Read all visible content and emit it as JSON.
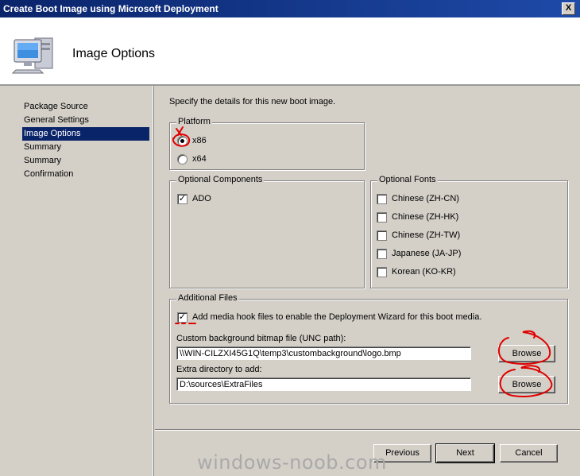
{
  "window": {
    "title": "Create Boot Image using Microsoft Deployment",
    "close_label": "X"
  },
  "header": {
    "title": "Image Options",
    "icon": "computer-icon"
  },
  "nav": {
    "items": [
      {
        "label": "Package Source"
      },
      {
        "label": "General Settings"
      },
      {
        "label": "Image Options"
      },
      {
        "label": "Summary"
      },
      {
        "label": "Summary"
      },
      {
        "label": "Confirmation"
      }
    ],
    "active_index": 2
  },
  "main": {
    "instruction": "Specify the details for this new boot image.",
    "platform": {
      "legend": "Platform",
      "options": [
        {
          "label": "x86",
          "checked": true
        },
        {
          "label": "x64",
          "checked": false
        }
      ]
    },
    "optional_components": {
      "legend": "Optional Components",
      "items": [
        {
          "label": "ADO",
          "checked": true
        }
      ]
    },
    "optional_fonts": {
      "legend": "Optional Fonts",
      "items": [
        {
          "label": "Chinese (ZH-CN)",
          "checked": false
        },
        {
          "label": "Chinese (ZH-HK)",
          "checked": false
        },
        {
          "label": "Chinese (ZH-TW)",
          "checked": false
        },
        {
          "label": "Japanese (JA-JP)",
          "checked": false
        },
        {
          "label": "Korean (KO-KR)",
          "checked": false
        }
      ]
    },
    "additional_files": {
      "legend": "Additional Files",
      "media_hook_label": "Add media hook files to enable the Deployment Wizard for this boot media.",
      "media_hook_checked": true,
      "bitmap_label": "Custom background bitmap file (UNC path):",
      "bitmap_value": "\\\\WIN-CILZXI45G1Q\\temp3\\custombackground\\logo.bmp",
      "extra_dir_label": "Extra directory to add:",
      "extra_dir_value": "D:\\sources\\ExtraFiles",
      "browse_label": "Browse"
    }
  },
  "footer": {
    "previous_label": "Previous",
    "next_label": "Next",
    "cancel_label": "Cancel"
  },
  "watermark": "windows-noob.com",
  "colors": {
    "titlebar": "#0a246a",
    "selection": "#0a246a",
    "dialog_bg": "#d4d0c8",
    "annotation": "#e00000"
  }
}
